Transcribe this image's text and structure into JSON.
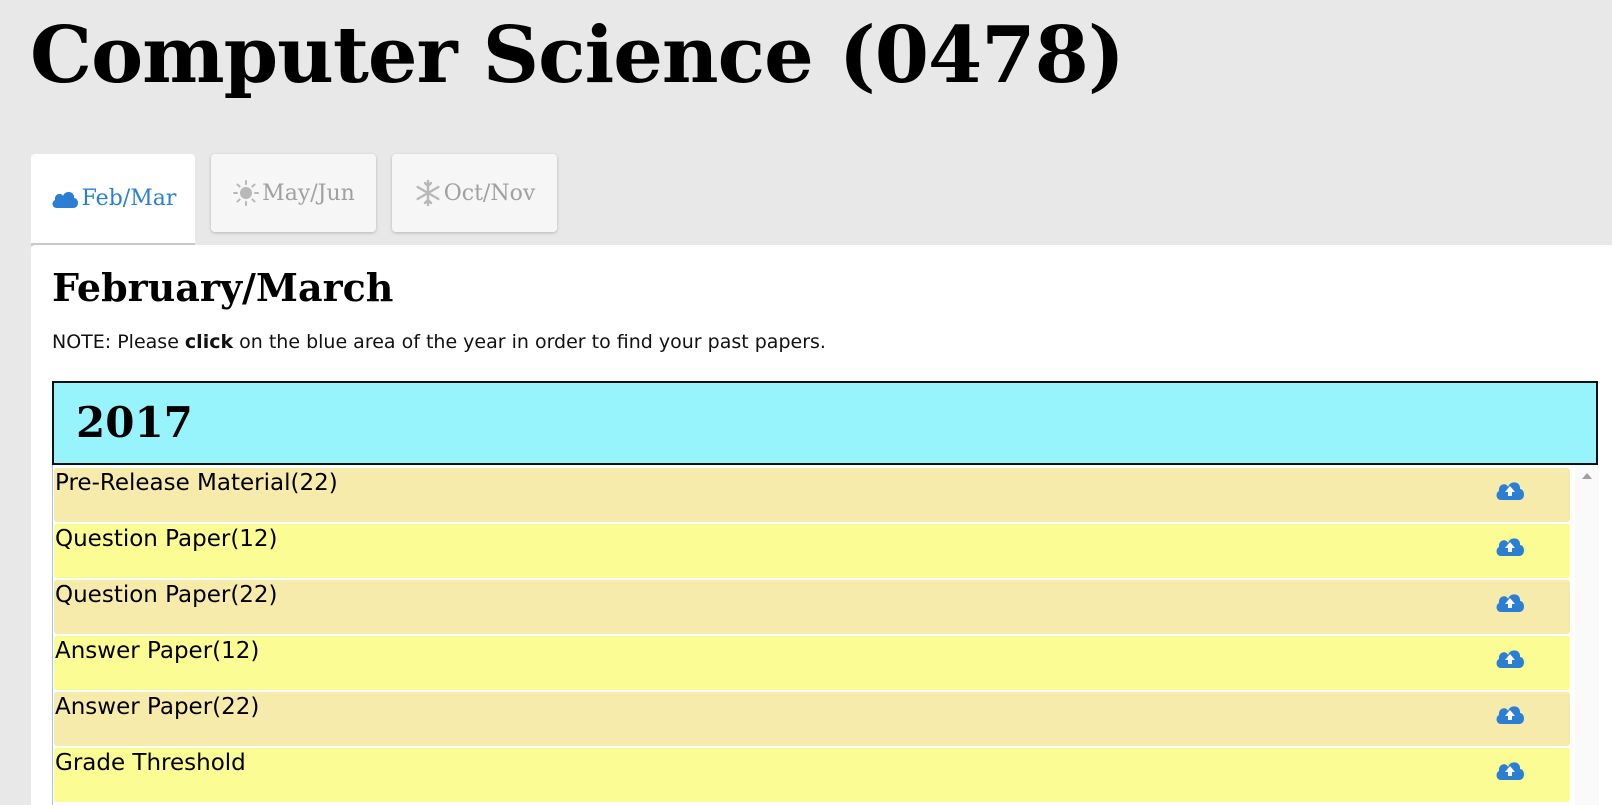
{
  "header": {
    "title": "Computer Science (0478)"
  },
  "tabs": [
    {
      "label": "Feb/Mar",
      "icon": "cloud-icon",
      "active": true
    },
    {
      "label": "May/Jun",
      "icon": "sun-icon",
      "active": false
    },
    {
      "label": "Oct/Nov",
      "icon": "snowflake-icon",
      "active": false
    }
  ],
  "section": {
    "title": "February/March",
    "note_prefix": "NOTE: Please ",
    "note_bold": "click",
    "note_suffix": " on the blue area of the year in order to find your past papers."
  },
  "year": {
    "label": "2017"
  },
  "papers": [
    {
      "label": "Pre-Release Material(22)",
      "icon": "upload-cloud-icon"
    },
    {
      "label": "Question Paper(12)",
      "icon": "upload-cloud-icon"
    },
    {
      "label": "Question Paper(22)",
      "icon": "upload-cloud-icon"
    },
    {
      "label": "Answer Paper(12)",
      "icon": "upload-cloud-icon"
    },
    {
      "label": "Answer Paper(22)",
      "icon": "upload-cloud-icon"
    },
    {
      "label": "Grade Threshold",
      "icon": "upload-cloud-icon"
    }
  ],
  "colors": {
    "background": "#e8e8e8",
    "accent": "#2a7fd4",
    "year_bg": "#98f4fc",
    "row_tan": "#f6ebaa",
    "row_yellow": "#fcfc94",
    "inactive_tab_text": "#a0a0a0"
  }
}
